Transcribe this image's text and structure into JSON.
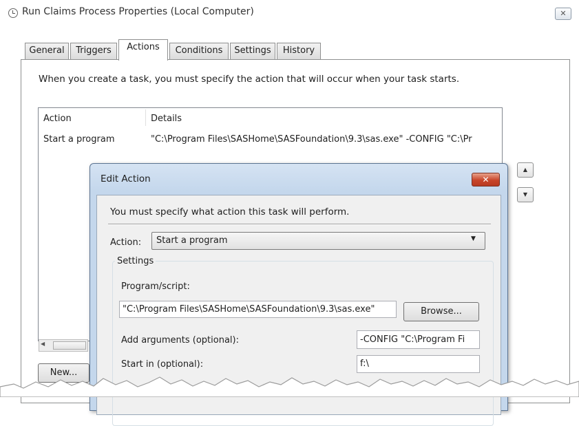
{
  "window": {
    "title": "Run Claims Process Properties (Local Computer)",
    "close_glyph": "✕"
  },
  "tabs": [
    "General",
    "Triggers",
    "Actions",
    "Conditions",
    "Settings",
    "History"
  ],
  "active_tab": "Actions",
  "actions_tab": {
    "instruction": "When you create a task, you must specify the action that will occur when your task starts.",
    "columns": [
      "Action",
      "Details"
    ],
    "rows": [
      {
        "action": "Start a program",
        "details": "\"C:\\Program Files\\SASHome\\SASFoundation\\9.3\\sas.exe\" -CONFIG \"C:\\Pr"
      }
    ],
    "new_button": "New..."
  },
  "edit_action": {
    "title": "Edit Action",
    "prompt": "You must specify what action this task will perform.",
    "action_label": "Action:",
    "action_value": "Start a program",
    "settings_legend": "Settings",
    "program_label": "Program/script:",
    "program_value": "\"C:\\Program Files\\SASHome\\SASFoundation\\9.3\\sas.exe\"",
    "browse_button": "Browse...",
    "args_label": "Add arguments (optional):",
    "args_value": "-CONFIG \"C:\\Program Fi",
    "startin_label": "Start in (optional):",
    "startin_value": "f:\\"
  },
  "colors": {
    "dialog_frame": "#c4d7ec",
    "close_button_red": "#c8452a"
  }
}
